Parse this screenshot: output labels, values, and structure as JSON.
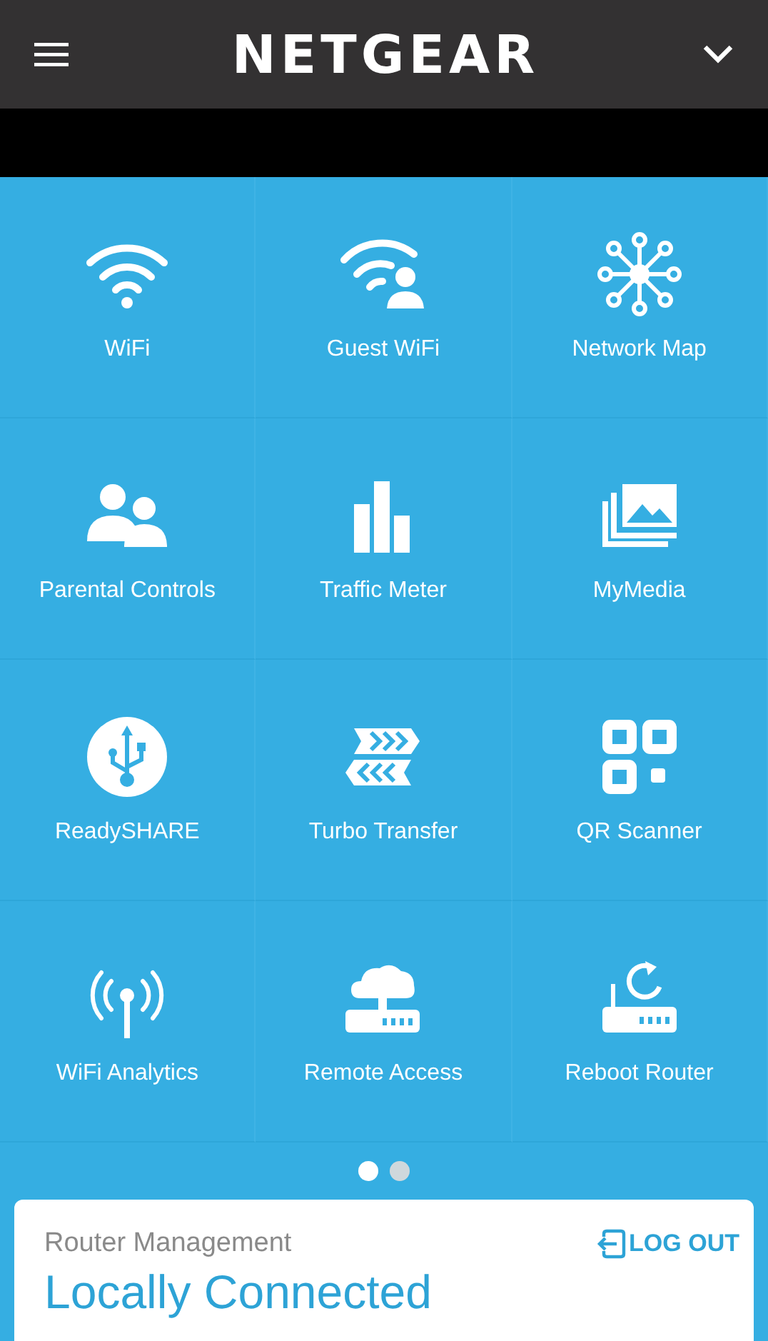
{
  "header": {
    "logo": "NETGEAR"
  },
  "tiles": [
    {
      "label": "WiFi",
      "kind": "wifi"
    },
    {
      "label": "Guest WiFi",
      "kind": "guest"
    },
    {
      "label": "Network Map",
      "kind": "network"
    },
    {
      "label": "Parental Controls",
      "kind": "parental"
    },
    {
      "label": "Traffic Meter",
      "kind": "traffic"
    },
    {
      "label": "MyMedia",
      "kind": "media"
    },
    {
      "label": "ReadySHARE",
      "kind": "usb"
    },
    {
      "label": "Turbo Transfer",
      "kind": "turbo"
    },
    {
      "label": "QR Scanner",
      "kind": "qr"
    },
    {
      "label": "WiFi Analytics",
      "kind": "analytics"
    },
    {
      "label": "Remote Access",
      "kind": "remote"
    },
    {
      "label": "Reboot Router",
      "kind": "reboot"
    }
  ],
  "pages": [
    {
      "selected": true
    },
    {
      "selected": false
    }
  ],
  "card": {
    "subtitle": "Router Management",
    "status": "Locally Connected",
    "logout": "LOG OUT"
  }
}
